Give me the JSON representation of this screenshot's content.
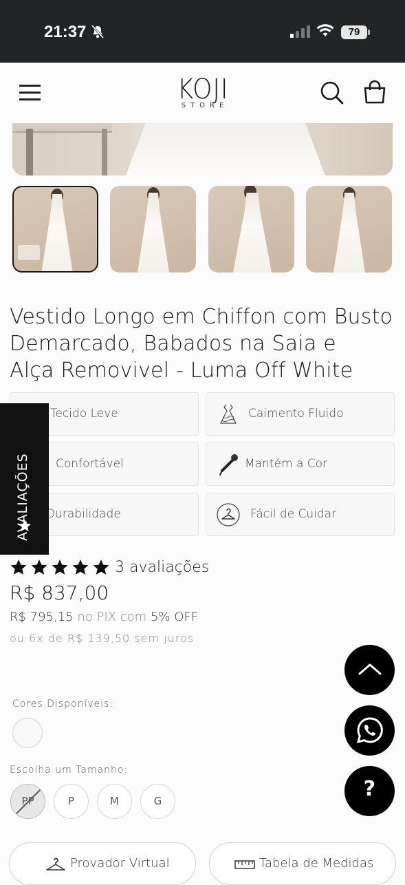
{
  "status_bar": {
    "time": "21:37",
    "battery": "79"
  },
  "brand": {
    "name": "KOJI",
    "tagline": "STORE"
  },
  "product": {
    "title_lines": [
      "Vestido Longo em Chiffon com Busto",
      "Demarcado, Babados na Saia e",
      "Alça Removivel - Luma Off White"
    ],
    "features": [
      {
        "label": "Tecido Leve",
        "icon": "feather-icon"
      },
      {
        "label": "Caimento Fluido",
        "icon": "dress-icon"
      },
      {
        "label": "Confortável",
        "icon": "comfort-icon"
      },
      {
        "label": "Mantém a Cor",
        "icon": "dropper-icon"
      },
      {
        "label": "Durabilidade",
        "icon": "shield-icon"
      },
      {
        "label": "Fácil de Cuidar",
        "icon": "hanger-icon"
      }
    ],
    "rating": {
      "stars": 5,
      "count_label": "3 avaliações"
    },
    "price": "R$ 837,00",
    "pix": {
      "price": "R$ 795,15",
      "middle": "no PIX com",
      "discount": "5% OFF"
    },
    "installments": "ou 6x de R$ 139,50 sem juros",
    "colors_label": "Cores Disponíveis:",
    "sizes_label": "Escolha um Tamanho:",
    "sizes": [
      "PP",
      "P",
      "M",
      "G"
    ],
    "size_unavailable": "PP"
  },
  "reviews_tab": {
    "label": "AVALIAÇÕES"
  },
  "actions": {
    "try_on": "Provador Virtual",
    "size_chart": "Tabela de Medidas"
  },
  "fab": {
    "help": "?"
  },
  "colors": {
    "accent": "#000000",
    "status_bar": "#222426"
  }
}
